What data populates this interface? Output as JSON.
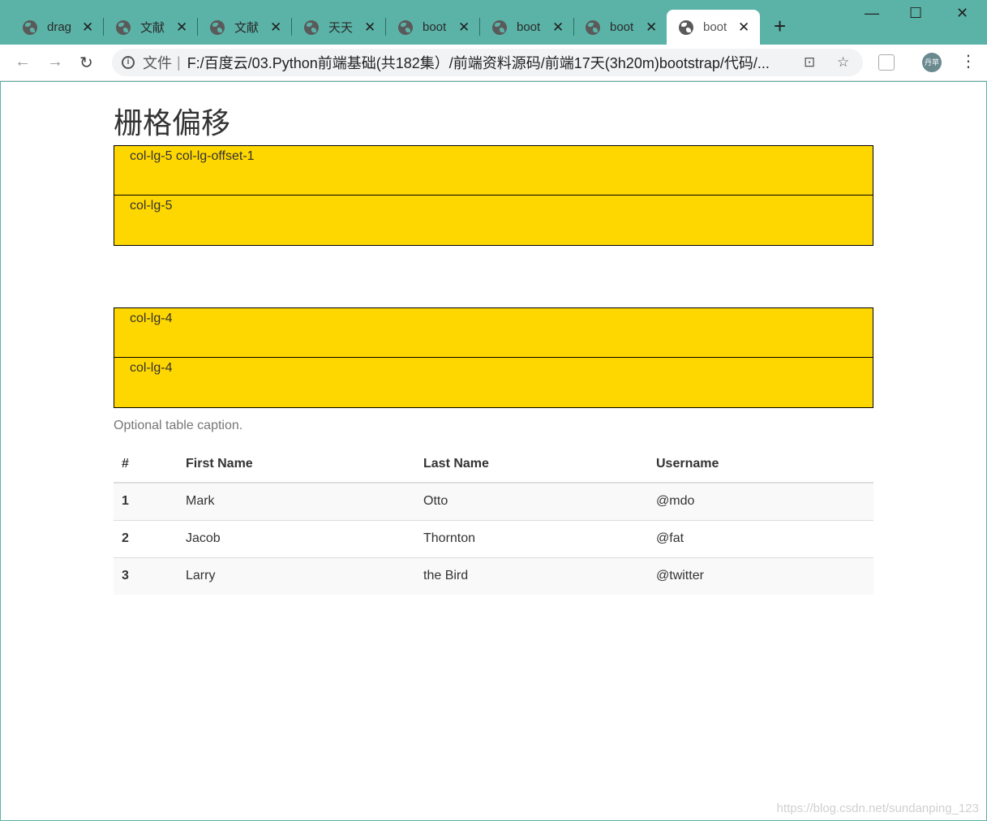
{
  "tabs": [
    {
      "title": "drag",
      "close": "✕"
    },
    {
      "title": "文献",
      "close": "✕"
    },
    {
      "title": "文献",
      "close": "✕"
    },
    {
      "title": "天天",
      "close": "✕"
    },
    {
      "title": "boot",
      "close": "✕"
    },
    {
      "title": "boot",
      "close": "✕"
    },
    {
      "title": "boot",
      "close": "✕"
    },
    {
      "title": "boot",
      "close": "✕"
    }
  ],
  "window": {
    "new_tab": "+",
    "minimize": "—",
    "maximize": "☐",
    "close": "✕"
  },
  "toolbar": {
    "back": "←",
    "forward": "→",
    "reload": "↻",
    "info_icon": "i",
    "file_label": "文件",
    "url": "F:/百度云/03.Python前端基础(共182集）/前端资料源码/前端17天(3h20m)bootstrap/代码/...",
    "translate": "⊡",
    "bookmark": "☆",
    "avatar": "丹苹",
    "menu": "⋮"
  },
  "page": {
    "heading": "栅格偏移",
    "row1": [
      "col-lg-5 col-lg-offset-1",
      "col-lg-5"
    ],
    "row2": [
      "col-lg-4",
      "col-lg-4"
    ],
    "caption": "Optional table caption.",
    "table": {
      "headers": [
        "#",
        "First Name",
        "Last Name",
        "Username"
      ],
      "rows": [
        [
          "1",
          "Mark",
          "Otto",
          "@mdo"
        ],
        [
          "2",
          "Jacob",
          "Thornton",
          "@fat"
        ],
        [
          "3",
          "Larry",
          "the Bird",
          "@twitter"
        ]
      ]
    },
    "watermark": "https://blog.csdn.net/sundanping_123"
  },
  "colors": {
    "frame": "#5bb3a8",
    "cell_bg": "#ffd700"
  }
}
